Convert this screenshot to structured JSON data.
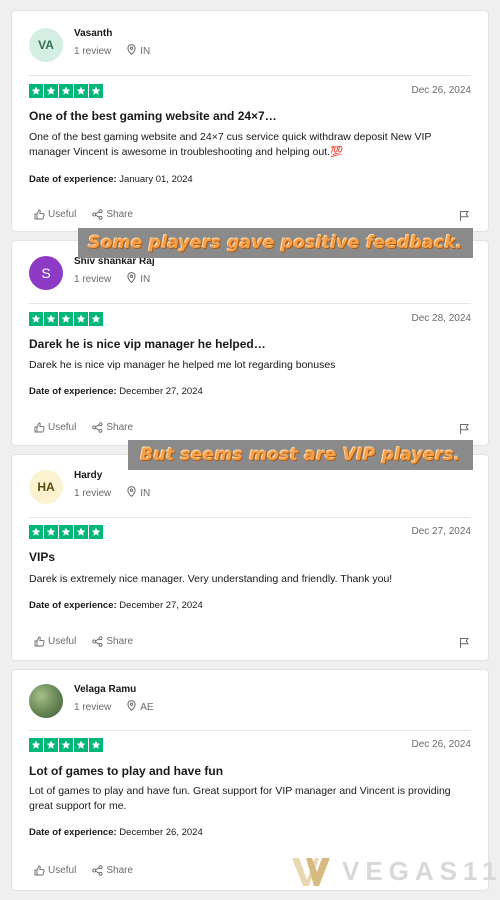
{
  "actions": {
    "useful": "Useful",
    "share": "Share"
  },
  "exp_label": "Date of experience:",
  "colors": {
    "star_green": "#00b67a",
    "banner_bg": "#8a8a8a",
    "banner_text": "#f5a04a"
  },
  "reviews": [
    {
      "avatar": "VA",
      "avatar_bg": "#d5eee3",
      "avatar_fg": "#2f6e55",
      "name": "Vasanth",
      "reviews_count": "1 review",
      "country": "IN",
      "rating": 5,
      "date": "Dec 26, 2024",
      "title": "One of the best gaming website and 24×7…",
      "body": "One of the best gaming website and 24×7 cus service quick withdraw deposit New VIP manager Vincent is awesome in troubleshooting and helping out.💯",
      "experience_date": "January 01, 2024"
    },
    {
      "avatar": "S",
      "avatar_bg": "#8d3ac4",
      "avatar_fg": "#ffffff",
      "name": "Shiv shankar Raj",
      "reviews_count": "1 review",
      "country": "IN",
      "rating": 5,
      "date": "Dec 28, 2024",
      "title": "Darek he is nice vip manager he helped…",
      "body": "Darek he is nice vip manager he helped me lot regarding bonuses",
      "experience_date": "December 27, 2024"
    },
    {
      "avatar": "HA",
      "avatar_bg": "#fbf3cf",
      "avatar_fg": "#5a4a10",
      "name": "Hardy",
      "reviews_count": "1 review",
      "country": "IN",
      "rating": 5,
      "date": "Dec 27, 2024",
      "title": "VIPs",
      "body": "Darek is extremely nice manager. Very understanding and friendly. Thank you!",
      "experience_date": "December 27, 2024"
    },
    {
      "avatar": "",
      "avatar_bg": "#6f8f5c",
      "avatar_fg": "#ffffff",
      "name": "Velaga Ramu",
      "reviews_count": "1 review",
      "country": "AE",
      "rating": 5,
      "date": "Dec 26, 2024",
      "title": "Lot of games to play and have fun",
      "body": "Lot of games to play and have fun. Great support for VIP manager and Vincent is providing great support for me.",
      "experience_date": "December 26, 2024"
    }
  ],
  "banners": {
    "first": "Some players gave positive feedback.",
    "second": "But seems most are VIP players."
  },
  "logo": {
    "text": "VEGAS11"
  }
}
